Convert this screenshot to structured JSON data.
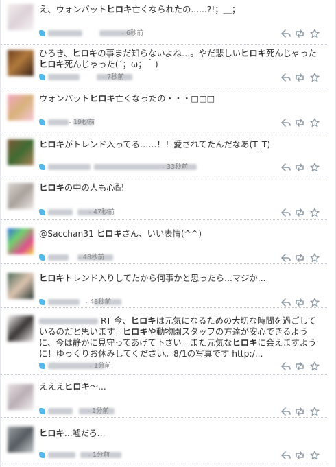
{
  "tweets": [
    {
      "text_segments": [
        {
          "t": "え、ウォンバット"
        },
        {
          "t": "ヒロキ",
          "b": true
        },
        {
          "t": "亡くなられたの......?!；＿；"
        }
      ],
      "time": "6秒前",
      "avatar_color": "#e6dee2"
    },
    {
      "text_segments": [
        {
          "t": "ひろき、"
        },
        {
          "t": "ヒロキ",
          "b": true
        },
        {
          "t": "の事まだ知らないよね…。やだ悲しい"
        },
        {
          "t": "ヒロキ",
          "b": true
        },
        {
          "t": "死んじゃった"
        },
        {
          "t": "ヒロキ",
          "b": true
        },
        {
          "t": "死んじゃった(´；ω；｀)"
        }
      ],
      "time": "7秒前",
      "avatar_color": "#7a4a25"
    },
    {
      "text_segments": [
        {
          "t": "ウォンバット"
        },
        {
          "t": "ヒロキ",
          "b": true
        },
        {
          "t": "亡くなったの・・・□□□"
        }
      ],
      "time": "19秒前",
      "avatar_color": "#f0b5c5"
    },
    {
      "text_segments": [
        {
          "t": "ヒロキ",
          "b": true
        },
        {
          "t": "がトレンド入ってる……！！愛されてたんだなあ(T_T)"
        }
      ],
      "time": "33秒前",
      "avatar_color": "#6e5a3a"
    },
    {
      "text_segments": [
        {
          "t": "ヒロキ",
          "b": true
        },
        {
          "t": "の中の人も心配"
        }
      ],
      "time": "47秒前",
      "avatar_color": "#cfc8c3"
    },
    {
      "text_segments": [
        {
          "t": "@Sacchan31 "
        },
        {
          "t": "ヒロキ",
          "b": true
        },
        {
          "t": "さん、いい表情(^^)"
        }
      ],
      "time": "48秒前",
      "avatar_color": "#5a9ad8"
    },
    {
      "text_segments": [
        {
          "t": "ヒロキ",
          "b": true
        },
        {
          "t": "トレンド入りしてたから何事かと思ったら...マジか..."
        }
      ],
      "time": "48秒前",
      "avatar_color": "#6b7a6a"
    },
    {
      "text_segments": [
        {
          "t": "RT 今、"
        },
        {
          "t": "ヒロキ",
          "b": true
        },
        {
          "t": "は元気になるための大切な時間を過ごしているのだと思います。"
        },
        {
          "t": "ヒロキ",
          "b": true
        },
        {
          "t": "や動物園スタッフの方達が安心できるように、今は静かに見守ってあげて下さい。また元気な"
        },
        {
          "t": "ヒロキ",
          "b": true
        },
        {
          "t": "に会えますように！ゆっくりお休みしてください。8/1の写真です http:/..."
        }
      ],
      "time": "1分前",
      "avatar_color": "#a9a4a4"
    },
    {
      "text_segments": [
        {
          "t": "えええ"
        },
        {
          "t": "ヒロキ",
          "b": true
        },
        {
          "t": "〜..."
        }
      ],
      "time": "1分前",
      "avatar_color": "#d8d0d3"
    },
    {
      "text_segments": [
        {
          "t": "ヒロキ",
          "b": true
        },
        {
          "t": "...嘘だろ..."
        }
      ],
      "time": "1分前",
      "avatar_color": "#80868a"
    }
  ],
  "colors": {
    "text": "#333333",
    "meta": "#888888",
    "twitter_blue": "#54b8ea",
    "action_icon": "#8e9aa6",
    "divider": "#c9ccd1"
  },
  "icons": [
    "twitter-bird-icon",
    "reply-icon",
    "retweet-icon",
    "favorite-star-icon"
  ]
}
